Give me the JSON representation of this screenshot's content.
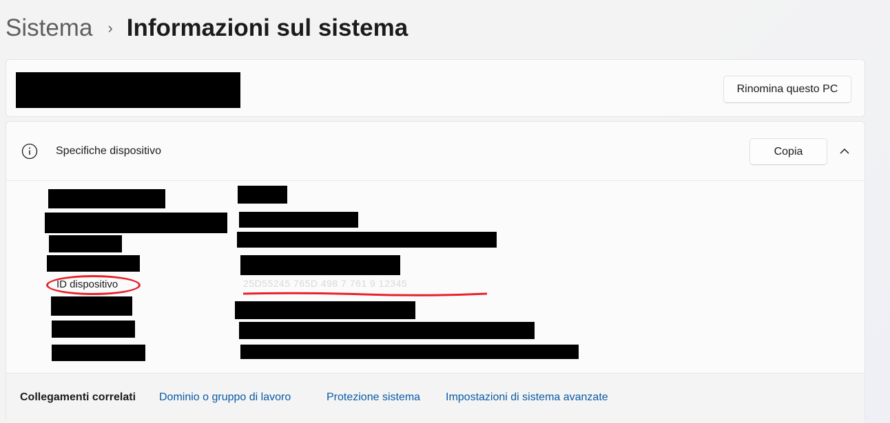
{
  "breadcrumb": {
    "parent": "Sistema",
    "separator": "›",
    "current": "Informazioni sul sistema"
  },
  "device_name_card": {
    "rename_button": "Rinomina questo PC"
  },
  "specs": {
    "title": "Specifiche dispositivo",
    "copy_button": "Copia",
    "device_id_label": "ID dispositivo",
    "device_id_value": "25D55245 765D 498  7     761  9 12345"
  },
  "related_links": {
    "title": "Collegamenti correlati",
    "items": [
      "Dominio o gruppo di lavoro",
      "Protezione sistema",
      "Impostazioni di sistema avanzate"
    ]
  },
  "icons": [
    "chevron-right-icon",
    "info-icon",
    "chevron-up-icon"
  ],
  "colors": {
    "link": "#0a5aa6",
    "annotation": "#e8202a",
    "redaction": "#000000"
  }
}
